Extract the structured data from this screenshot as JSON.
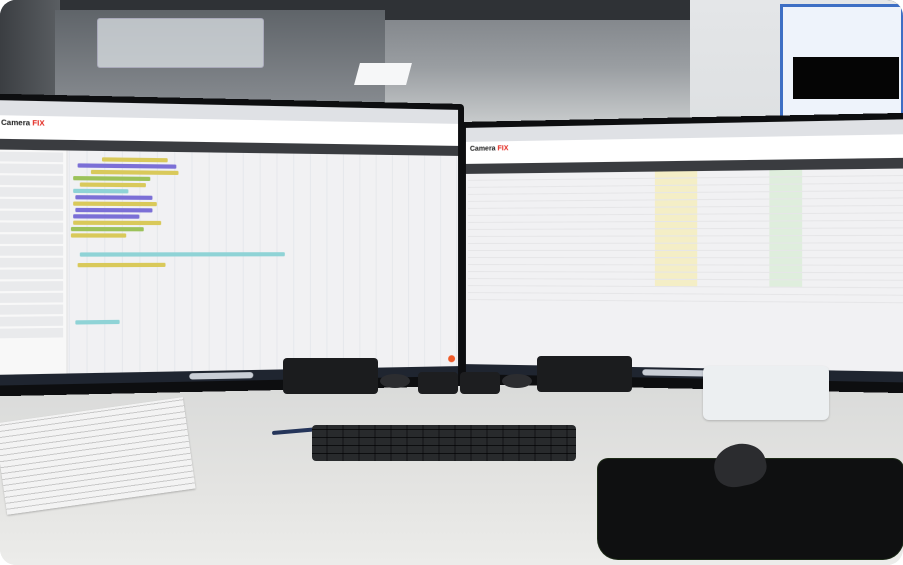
{
  "scene": {
    "left_monitor": {
      "app_name": "Camera",
      "app_accent": "FIX"
    },
    "right_monitor": {
      "app_name": "Camera",
      "app_accent": "FIX"
    },
    "colors": {
      "brand_red": "#e2231a",
      "bar_yellow": "#d9c95a",
      "bar_purple": "#7b6fd6",
      "bar_teal": "#8fd3d6",
      "bar_green": "#9cc25a",
      "fab_orange": "#f05a28"
    }
  }
}
